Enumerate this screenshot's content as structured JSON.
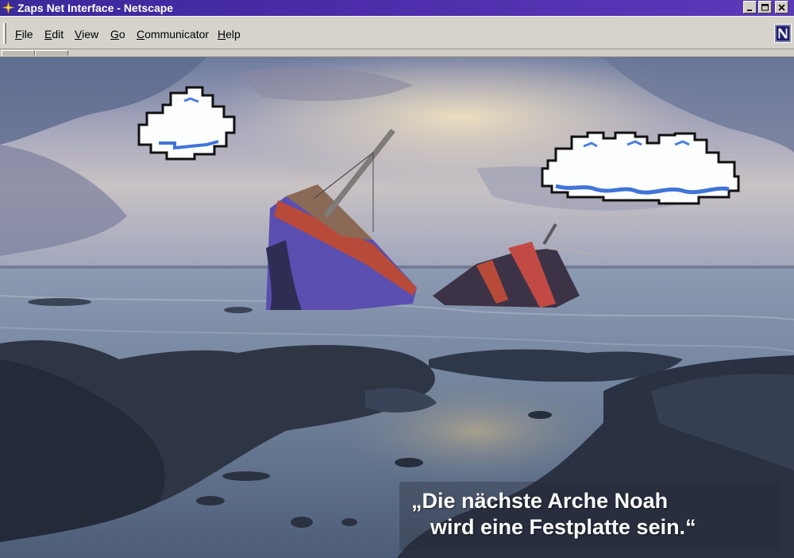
{
  "window": {
    "title": "Zaps Net Interface - Netscape",
    "buttons": [
      "minimize",
      "maximize",
      "close"
    ]
  },
  "menu": {
    "items": [
      {
        "label": "File",
        "accel": "F"
      },
      {
        "label": "Edit",
        "accel": "E"
      },
      {
        "label": "View",
        "accel": "V"
      },
      {
        "label": "Go",
        "accel": "G"
      },
      {
        "label": "Communicator",
        "accel": "C"
      },
      {
        "label": "Help",
        "accel": "H"
      }
    ]
  },
  "icons": {
    "app": "sparkle-icon",
    "browser_logo": "netscape-n-icon"
  },
  "content": {
    "caption_line1": "„Die nächste Arche Noah",
    "caption_line2": "wird eine Festplatte sein.“"
  },
  "colors": {
    "titlebar": "#3a2a9a",
    "menubar": "#d6d3cc",
    "sky": "#9ea7c4",
    "sea": "#6f819b",
    "rocks": "#2e3645",
    "boat_hull": "#5a4fb0"
  }
}
